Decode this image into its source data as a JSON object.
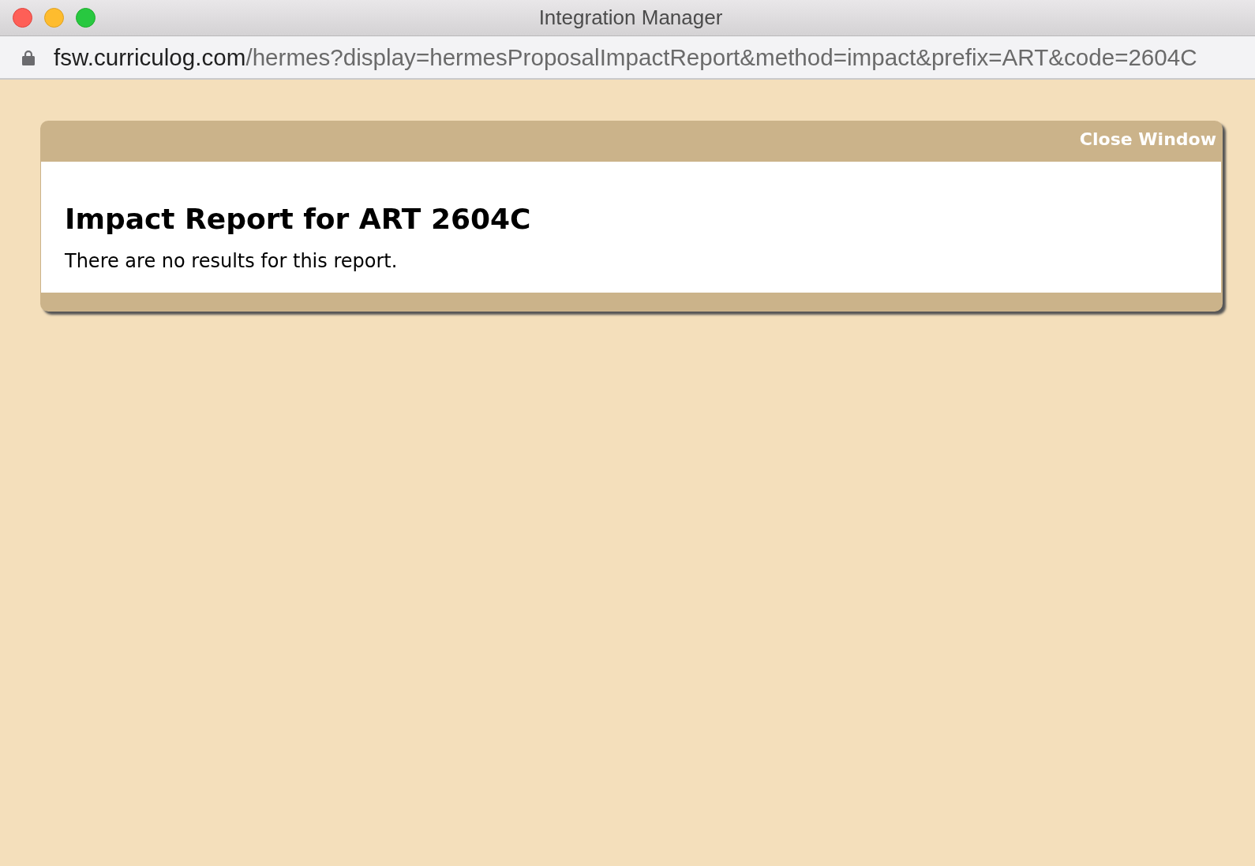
{
  "window": {
    "title": "Integration Manager"
  },
  "address_bar": {
    "secure": true,
    "host": "fsw.curriculog.com",
    "path": "/hermes?display=hermesProposalImpactReport&method=impact&prefix=ART&code=2604C"
  },
  "panel": {
    "close_link": "Close Window",
    "heading": "Impact Report for ART 2604C",
    "message": "There are no results for this report."
  }
}
